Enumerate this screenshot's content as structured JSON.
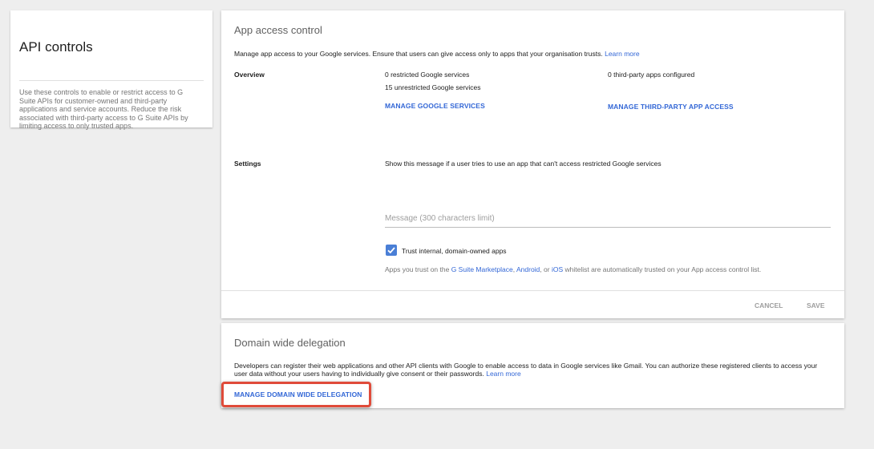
{
  "left_panel": {
    "title": "API controls",
    "description": "Use these controls to enable or restrict access to G Suite APIs for customer-owned and third-party applications and service accounts. Reduce the risk associated with third-party access to G Suite APIs by limiting access to only trusted apps."
  },
  "app_access": {
    "title": "App access control",
    "intro": "Manage app access to your Google services. Ensure that users can give access only to apps that your organisation trusts.",
    "learn_more": "Learn more",
    "overview_label": "Overview",
    "restricted": "0 restricted Google services",
    "unrestricted": "15 unrestricted Google services",
    "manage_google_services": "MANAGE GOOGLE SERVICES",
    "third_party_configured": "0 third-party apps configured",
    "manage_third_party": "MANAGE THIRD-PARTY APP ACCESS",
    "settings_label": "Settings",
    "settings_message_prompt": "Show this message if a user tries to use an app that can't access restricted Google services",
    "message_placeholder": "Message (300 characters limit)",
    "message_value": "",
    "trust_checkbox_label": "Trust internal, domain-owned apps",
    "trust_checked": true,
    "trusted_note_prefix": "Apps you trust on the ",
    "trusted_note_marketplace": "G Suite Marketplace",
    "trusted_note_comma": ", ",
    "trusted_note_android": "Android",
    "trusted_note_or": ", or ",
    "trusted_note_ios": "iOS",
    "trusted_note_suffix": " whitelist are automatically trusted on your App access control list.",
    "cancel_label": "CANCEL",
    "save_label": "SAVE"
  },
  "domain_delegation": {
    "title": "Domain wide delegation",
    "description": "Developers can register their web applications and other API clients with Google to enable access to data in Google services like Gmail. You can authorize these registered clients to access your user data without your users having to individually give consent or their passwords.",
    "learn_more": "Learn more",
    "manage_button": "MANAGE DOMAIN WIDE DELEGATION"
  },
  "colors": {
    "link": "#3367d6",
    "checkbox": "#4a7fd6",
    "highlight_border": "#e04b3a",
    "background": "#eeeeee"
  }
}
